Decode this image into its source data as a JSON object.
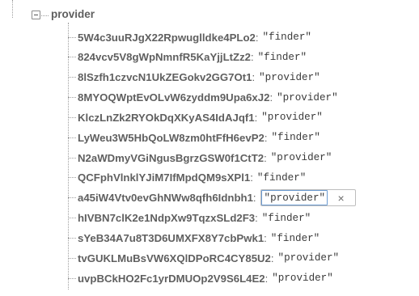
{
  "tree": {
    "parent": {
      "name": "provider",
      "expanded": true
    },
    "children": [
      {
        "key": "5W4c3uuRJgX22Rpwuglldke4PLo2",
        "value": "\"finder\""
      },
      {
        "key": "824vcv5V8gWpNmnfR5KaYjjLtZz2",
        "value": "\"finder\""
      },
      {
        "key": "8lSzfh1czvcN1UkZEGokv2GG7Ot1",
        "value": "\"provider\""
      },
      {
        "key": "8MYOQWptEvOLvW6zyddm9Upa6xJ2",
        "value": "\"provider\""
      },
      {
        "key": "KlczLnZk2RYOkDqXKyAS4IdAJqf1",
        "value": "\"provider\""
      },
      {
        "key": "LyWeu3W5HbQoLW8zm0htFfH6evP2",
        "value": "\"finder\""
      },
      {
        "key": "N2aWDmyVGiNgusBgrzGSW0f1CtT2",
        "value": "\"provider\""
      },
      {
        "key": "QCFphVlnklYJiM7IfMpdQM9sXPl1",
        "value": "\"finder\""
      },
      {
        "key": "a45iW4Vtv0evGhNWw8qfh6Idnbh1",
        "value": "\"provider\"",
        "editing": true,
        "clear_icon": "×"
      },
      {
        "key": "hIVBN7clK2e1NdpXw9TqzxSLd2F3",
        "value": "\"finder\""
      },
      {
        "key": "sYeB34A7u8T3D6UMXFX8Y7cbPwk1",
        "value": "\"finder\""
      },
      {
        "key": "tvGUKLMuBsVW6XQlDPoRC4CY85U2",
        "value": "\"provider\""
      },
      {
        "key": "uvpBCkHO2Fc1yrDMUOp2V9S6L4E2",
        "value": "\"provider\""
      }
    ]
  },
  "icons": {
    "toggle": "collapse-minus-icon",
    "clear": "close-icon"
  }
}
